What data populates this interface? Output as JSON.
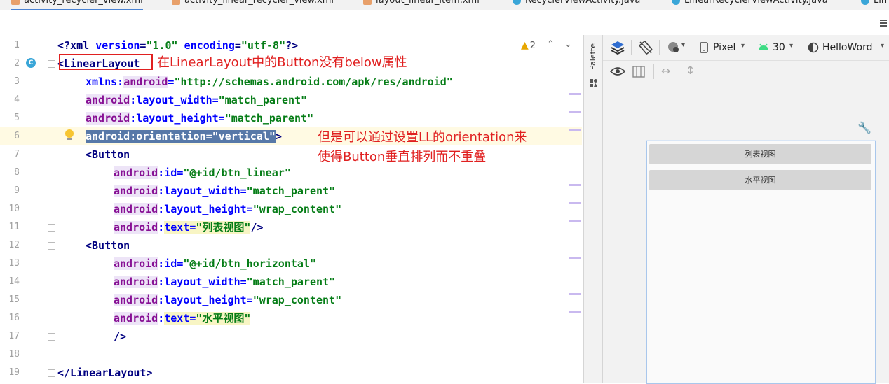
{
  "tabs": [
    {
      "label": "activity_recycler_view.xml",
      "active": true
    },
    {
      "label": "activity_linear_recycler_view.xml",
      "active": false
    },
    {
      "label": "layout_linear_item.xml",
      "active": false
    },
    {
      "label": "RecyclerViewActivity.java",
      "active": false
    },
    {
      "label": "LinearRecyclerViewActivity.java",
      "active": false
    },
    {
      "label": "Lin",
      "active": false
    }
  ],
  "editor": {
    "warnings": {
      "icon": "warning-icon",
      "count": "2"
    },
    "lines": [
      {
        "n": "1"
      },
      {
        "n": "2"
      },
      {
        "n": "3"
      },
      {
        "n": "4"
      },
      {
        "n": "5"
      },
      {
        "n": "6"
      },
      {
        "n": "7"
      },
      {
        "n": "8"
      },
      {
        "n": "9"
      },
      {
        "n": "10"
      },
      {
        "n": "11"
      },
      {
        "n": "12"
      },
      {
        "n": "13"
      },
      {
        "n": "14"
      },
      {
        "n": "15"
      },
      {
        "n": "16"
      },
      {
        "n": "17"
      },
      {
        "n": "18"
      },
      {
        "n": "19"
      }
    ],
    "code": {
      "l1_a": "<?xml ",
      "l1_b": "version",
      "l1_c": "=",
      "l1_d": "\"1.0\"",
      "l1_e": " encoding",
      "l1_f": "=",
      "l1_g": "\"utf-8\"",
      "l1_h": "?>",
      "l2": "<LinearLayout",
      "l3_ns": "xmlns:",
      "l3_a": "android",
      "l3_b": "=",
      "l3_v": "\"http://schemas.android.com/apk/res/android\"",
      "ns": "android",
      "colon": ":",
      "l4_attr": "layout_width",
      "l4_v": "\"match_parent\"",
      "l5_attr": "layout_height",
      "l5_v": "\"match_parent\"",
      "l6_sel": "android:orientation=\"vertical\"",
      "l6_end": ">",
      "l7": "<Button",
      "l8_attr": "id",
      "l8_v": "\"@+id/btn_linear\"",
      "l9_attr": "layout_width",
      "l9_v": "\"match_parent\"",
      "l10_attr": "layout_height",
      "l10_v": "\"wrap_content\"",
      "l11_attr": "text",
      "l11_v": "\"列表视图\"",
      "l11_end": "/>",
      "l12": "<Button",
      "l13_attr": "id",
      "l13_v": "\"@+id/btn_horizontal\"",
      "l14_attr": "layout_width",
      "l14_v": "\"match_parent\"",
      "l15_attr": "layout_height",
      "l15_v": "\"wrap_content\"",
      "l16_attr": "text",
      "l16_v": "\"水平视图\"",
      "l17": "/>",
      "l19": "</LinearLayout>",
      "eq": "="
    }
  },
  "annotations": {
    "a1": "在LinearLayout中的Button没有below属性",
    "a2_line1": "但是可以通过设置LL的orientation来",
    "a2_line2": "使得Button垂直排列而不重叠",
    "color": "#e02020"
  },
  "palette": {
    "label": "Palette"
  },
  "design": {
    "device": "Pixel",
    "api": "30",
    "theme": "HelloWord",
    "preview_buttons": [
      "列表视图",
      "水平视图"
    ]
  }
}
